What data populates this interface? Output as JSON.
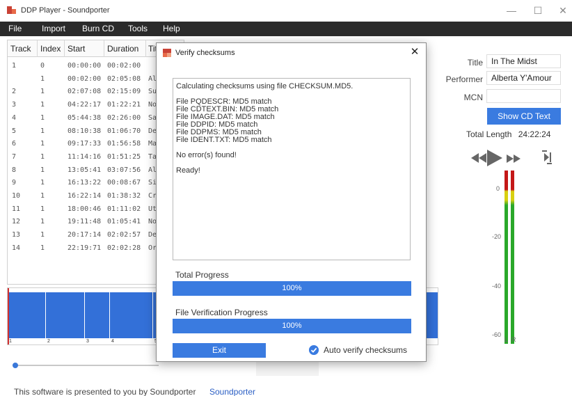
{
  "window": {
    "title": "DDP Player - Soundporter",
    "minimize_glyph": "—",
    "maximize_glyph": "☐",
    "close_glyph": "✕"
  },
  "menu": [
    "File",
    "Import",
    "Burn CD",
    "Tools",
    "Help"
  ],
  "table": {
    "headers": [
      "Track",
      "Index",
      "Start",
      "Duration",
      "Tit"
    ],
    "rows": [
      {
        "track": "1",
        "index": "0",
        "start": "00:00:00",
        "duration": "00:02:00",
        "title": ""
      },
      {
        "track": "",
        "index": "1",
        "start": "00:02:00",
        "duration": "02:05:08",
        "title": "Al"
      },
      {
        "track": "2",
        "index": "1",
        "start": "02:07:08",
        "duration": "02:15:09",
        "title": "Su"
      },
      {
        "track": "3",
        "index": "1",
        "start": "04:22:17",
        "duration": "01:22:21",
        "title": "No"
      },
      {
        "track": "4",
        "index": "1",
        "start": "05:44:38",
        "duration": "02:26:00",
        "title": "Sa"
      },
      {
        "track": "5",
        "index": "1",
        "start": "08:10:38",
        "duration": "01:06:70",
        "title": "De"
      },
      {
        "track": "6",
        "index": "1",
        "start": "09:17:33",
        "duration": "01:56:58",
        "title": "Ma"
      },
      {
        "track": "7",
        "index": "1",
        "start": "11:14:16",
        "duration": "01:51:25",
        "title": "Ta"
      },
      {
        "track": "8",
        "index": "1",
        "start": "13:05:41",
        "duration": "03:07:56",
        "title": "Al"
      },
      {
        "track": "9",
        "index": "1",
        "start": "16:13:22",
        "duration": "00:08:67",
        "title": "Sir"
      },
      {
        "track": "10",
        "index": "1",
        "start": "16:22:14",
        "duration": "01:38:32",
        "title": "Cr"
      },
      {
        "track": "11",
        "index": "1",
        "start": "18:00:46",
        "duration": "01:11:02",
        "title": "Ut"
      },
      {
        "track": "12",
        "index": "1",
        "start": "19:11:48",
        "duration": "01:05:41",
        "title": "No"
      },
      {
        "track": "13",
        "index": "1",
        "start": "20:17:14",
        "duration": "02:02:57",
        "title": "De"
      },
      {
        "track": "14",
        "index": "1",
        "start": "22:19:71",
        "duration": "02:02:28",
        "title": "Or"
      }
    ]
  },
  "waveform": {
    "marker_labels": [
      "1",
      "2",
      "3",
      "4",
      "5"
    ]
  },
  "footer": {
    "text": "This software is presented to you by Soundporter",
    "link": "Soundporter"
  },
  "cd_info": {
    "title_label": "Title",
    "title_value": "In The Midst",
    "performer_label": "Performer",
    "performer_value": "Alberta Y'Amour",
    "mcn_label": "MCN",
    "mcn_value": "",
    "show_cd_text_button": "Show CD Text",
    "total_length_label": "Total Length",
    "total_length_value": "24:22:24"
  },
  "vu_meter": {
    "scale": [
      "0",
      "-20",
      "-40",
      "-60"
    ],
    "left_label": "L",
    "right_label": "R"
  },
  "dialog": {
    "title": "Verify checksums",
    "close_glyph": "✕",
    "log_lines": [
      "Calculating checksums using file CHECKSUM.MD5.",
      "",
      "File PQDESCR: MD5 match",
      "File CDTEXT.BIN: MD5 match",
      "File IMAGE.DAT: MD5 match",
      "File DDPID: MD5 match",
      "File DDPMS: MD5 match",
      "File IDENT.TXT: MD5 match",
      "",
      "No error(s) found!",
      "",
      "Ready!"
    ],
    "total_progress_label": "Total Progress",
    "total_progress": 1.0,
    "total_progress_text": "100%",
    "file_progress_label": "File Verification Progress",
    "file_progress": 1.0,
    "file_progress_text": "100%",
    "exit_button": "Exit",
    "auto_verify_label": "Auto verify checksums",
    "auto_verify_checked": true
  },
  "colors": {
    "accent": "#3a7be0",
    "waveform": "#3370d8",
    "menubar": "#2b2b2b"
  }
}
